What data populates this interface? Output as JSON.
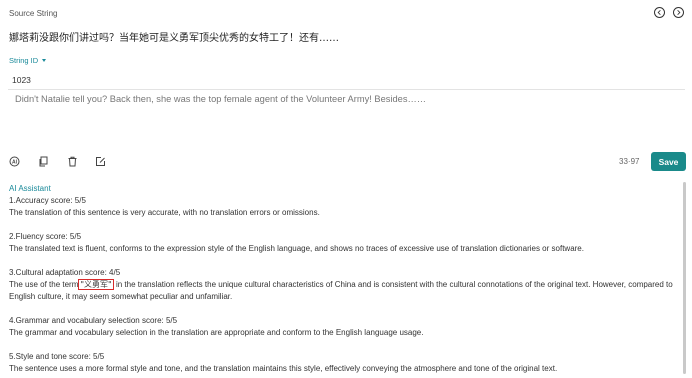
{
  "header": {
    "source_label": "Source String",
    "prev_icon": "chevron-left-icon",
    "next_icon": "chevron-right-icon"
  },
  "source_text": "娜塔莉没跟你们讲过吗？当年她可是义勇军顶尖优秀的女特工了！还有……",
  "string_id": {
    "label": "String ID",
    "value": "1023"
  },
  "translation": {
    "text": "Didn't Natalie tell you? Back then, she was the top female agent of the Volunteer Army! Besides……"
  },
  "toolbar": {
    "icons": [
      "ai-icon",
      "copy-icon",
      "delete-icon",
      "edit-icon"
    ],
    "char_count": "33·97",
    "save_label": "Save"
  },
  "assistant": {
    "title": "AI Assistant",
    "items": [
      {
        "score": "1.Accuracy score: 5/5",
        "text": "The translation of this sentence is very accurate, with no translation errors or omissions."
      },
      {
        "score": "2.Fluency score: 5/5",
        "text": "The translated text is fluent, conforms to the expression style of the English language, and shows no traces of excessive use of translation dictionaries or software."
      },
      {
        "score": "3.Cultural adaptation score: 4/5",
        "text_before": "The use of the term",
        "term": "\"义勇军\"",
        "text_after": "in the translation reflects the unique cultural characteristics of China and is consistent with the cultural connotations of the original text. However, compared to English culture, it may seem somewhat peculiar and unfamiliar."
      },
      {
        "score": "4.Grammar and vocabulary selection score: 5/5",
        "text": "The grammar and vocabulary selection in the translation are appropriate and conform to the English language usage."
      },
      {
        "score": "5.Style and tone score: 5/5",
        "text": "The sentence uses a more formal style and tone, and the translation maintains this style, effectively conveying the atmosphere and tone of the original text."
      }
    ]
  },
  "colors": {
    "accent": "#1a8a9a",
    "save_button": "#1a8a8a",
    "highlight_border": "#d82b2b"
  }
}
